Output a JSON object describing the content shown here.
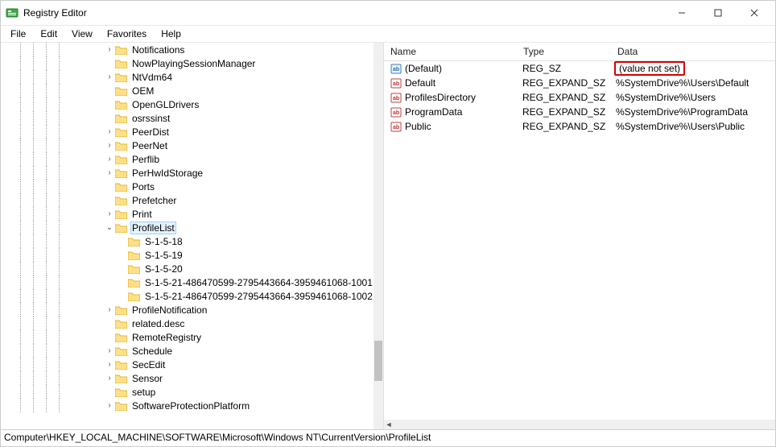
{
  "window": {
    "title": "Registry Editor"
  },
  "menu": {
    "file": "File",
    "edit": "Edit",
    "view": "View",
    "favorites": "Favorites",
    "help": "Help"
  },
  "tree": {
    "items": [
      {
        "depth": 8,
        "expand": ">",
        "label": "Notifications"
      },
      {
        "depth": 8,
        "expand": "",
        "label": "NowPlayingSessionManager"
      },
      {
        "depth": 8,
        "expand": ">",
        "label": "NtVdm64"
      },
      {
        "depth": 8,
        "expand": "",
        "label": "OEM"
      },
      {
        "depth": 8,
        "expand": "",
        "label": "OpenGLDrivers"
      },
      {
        "depth": 8,
        "expand": "",
        "label": "osrssinst"
      },
      {
        "depth": 8,
        "expand": ">",
        "label": "PeerDist"
      },
      {
        "depth": 8,
        "expand": ">",
        "label": "PeerNet"
      },
      {
        "depth": 8,
        "expand": ">",
        "label": "Perflib"
      },
      {
        "depth": 8,
        "expand": ">",
        "label": "PerHwIdStorage"
      },
      {
        "depth": 8,
        "expand": "",
        "label": "Ports"
      },
      {
        "depth": 8,
        "expand": "",
        "label": "Prefetcher"
      },
      {
        "depth": 8,
        "expand": ">",
        "label": "Print"
      },
      {
        "depth": 8,
        "expand": "v",
        "label": "ProfileList",
        "selected": true
      },
      {
        "depth": 9,
        "expand": "",
        "label": "S-1-5-18"
      },
      {
        "depth": 9,
        "expand": "",
        "label": "S-1-5-19"
      },
      {
        "depth": 9,
        "expand": "",
        "label": "S-1-5-20"
      },
      {
        "depth": 9,
        "expand": "",
        "label": "S-1-5-21-486470599-2795443664-3959461068-1001"
      },
      {
        "depth": 9,
        "expand": "",
        "label": "S-1-5-21-486470599-2795443664-3959461068-1002"
      },
      {
        "depth": 8,
        "expand": ">",
        "label": "ProfileNotification"
      },
      {
        "depth": 8,
        "expand": "",
        "label": "related.desc"
      },
      {
        "depth": 8,
        "expand": "",
        "label": "RemoteRegistry"
      },
      {
        "depth": 8,
        "expand": ">",
        "label": "Schedule"
      },
      {
        "depth": 8,
        "expand": ">",
        "label": "SecEdit"
      },
      {
        "depth": 8,
        "expand": ">",
        "label": "Sensor"
      },
      {
        "depth": 8,
        "expand": "",
        "label": "setup"
      },
      {
        "depth": 8,
        "expand": ">",
        "label": "SoftwareProtectionPlatform"
      }
    ]
  },
  "list": {
    "headers": {
      "name": "Name",
      "type": "Type",
      "data": "Data"
    },
    "rows": [
      {
        "icon": "sz-default",
        "name": "(Default)",
        "type": "REG_SZ",
        "data": "(value not set)",
        "highlight": true
      },
      {
        "icon": "sz",
        "name": "Default",
        "type": "REG_EXPAND_SZ",
        "data": "%SystemDrive%\\Users\\Default"
      },
      {
        "icon": "sz",
        "name": "ProfilesDirectory",
        "type": "REG_EXPAND_SZ",
        "data": "%SystemDrive%\\Users"
      },
      {
        "icon": "sz",
        "name": "ProgramData",
        "type": "REG_EXPAND_SZ",
        "data": "%SystemDrive%\\ProgramData"
      },
      {
        "icon": "sz",
        "name": "Public",
        "type": "REG_EXPAND_SZ",
        "data": "%SystemDrive%\\Users\\Public"
      }
    ]
  },
  "status": {
    "path": "Computer\\HKEY_LOCAL_MACHINE\\SOFTWARE\\Microsoft\\Windows NT\\CurrentVersion\\ProfileList"
  }
}
